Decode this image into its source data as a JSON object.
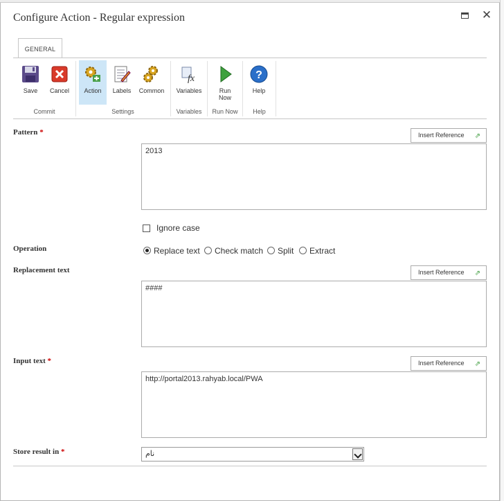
{
  "dialog": {
    "title": "Configure Action - Regular expression"
  },
  "ribbon": {
    "tab": "GENERAL",
    "buttons": {
      "save": "Save",
      "cancel": "Cancel",
      "action": "Action",
      "labels": "Labels",
      "common": "Common",
      "variables": "Variables",
      "run_now": "Run Now",
      "help": "Help"
    },
    "groups": {
      "commit": "Commit",
      "settings": "Settings",
      "variables": "Variables",
      "run_now": "Run Now",
      "help": "Help"
    },
    "icons": {
      "save": "floppy-disk-icon",
      "cancel": "red-x-icon",
      "action": "gears-icon",
      "labels": "notepad-pencil-icon",
      "common": "gears-icon",
      "variables": "fx-icon",
      "run_now": "green-play-icon",
      "help": "blue-question-icon"
    }
  },
  "form": {
    "insert_reference": "Insert Reference",
    "pattern": {
      "label": "Pattern",
      "required": "*",
      "value": "2013"
    },
    "ignore_case": {
      "label": "Ignore case",
      "checked": false
    },
    "operation": {
      "label": "Operation",
      "options": [
        "Replace text",
        "Check match",
        "Split",
        "Extract"
      ],
      "selected": "Replace text"
    },
    "replacement": {
      "label": "Replacement text",
      "value": "####"
    },
    "input": {
      "label": "Input text",
      "required": "*",
      "value": "http://portal2013.rahyab.local/PWA"
    },
    "store": {
      "label": "Store result in",
      "required": "*",
      "value": "نام"
    }
  },
  "colors": {
    "selected_button": "#cde6f7",
    "required": "#cc0000"
  }
}
